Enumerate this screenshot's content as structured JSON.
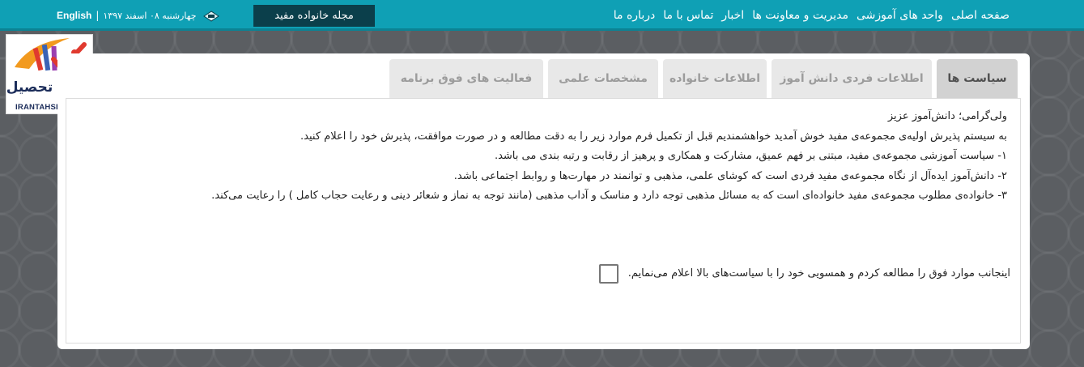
{
  "nav": {
    "items": [
      "صفحه اصلی",
      "واحد های آموزشی",
      "مدیریت و معاونت ها",
      "اخبار",
      "تماس با ما",
      "درباره ما"
    ],
    "magazine_button": "مجله خانواده مفید",
    "date": "چهارشنبه ۰۸ اسفند ۱۳۹۷",
    "separator": "|",
    "english_link": "English",
    "calendar_icon": "calendar-icon"
  },
  "logo": {
    "text_fa": "ایران تحصیل",
    "tagline": "IRANTAHSIL.ORG"
  },
  "tabs": [
    "سیاست ها",
    "اطلاعات فردی دانش آموز",
    "اطلاعات خانواده",
    "مشخصات علمی",
    "فعالیت های فوق برنامه"
  ],
  "content": {
    "greeting": "ولی‌گرامی؛ دانش‌آموز عزیز",
    "intro": "به سیستم پذیرش اولیه‌ی مجموعه‌ی مفید خوش آمدید خواهشمندیم قبل از تکمیل فرم موارد زیر را به دقت مطالعه و در صورت موافقت، پذیرش خود را اعلام کنید.",
    "item1": "۱- سیاست آموزشی مجموعه‌ی مفید، مبتنی بر فهم عمیق، مشارکت و همکاری و پرهیز از رقابت و رتبه بندی می باشد.",
    "item2": "۲- دانش‌آموز ایده‌آل از نگاه مجموعه‌ی مفید فردی است که کوشای علمی، مذهبی و توانمند در مهارت‌ها و روابط اجتماعی باشد.",
    "item3": "۳- خانواده‌ی مطلوب مجموعه‌ی مفید خانواده‌ای است که به مسائل مذهبی توجه دارد و مناسک و آداب مذهبی (مانند توجه به نماز و شعائر دینی و رعایت حجاب کامل ) را  رعایت می‌کند.",
    "agreement": "اینجانب موارد فوق را مطالعه کردم و همسویی خود را با سیاست‌های بالا اعلام می‌نمایم."
  },
  "colors": {
    "topbar": "#0fa0b5",
    "magazine_button": "#0b3f4b",
    "background": "#5b5e62",
    "active_tab": "#d2d2d2",
    "inactive_tab": "#e8e8e8"
  }
}
